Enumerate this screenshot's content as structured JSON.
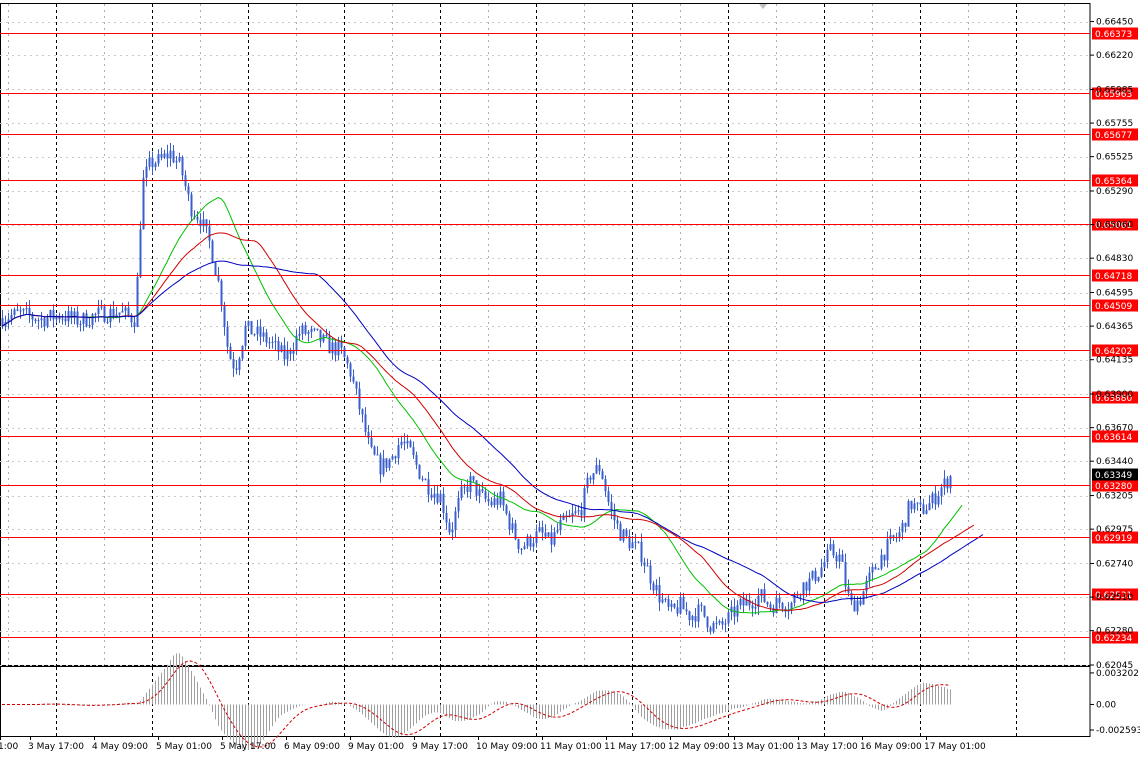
{
  "chart_data": {
    "type": "candlestick",
    "symbol_hint": "",
    "colors": {
      "background": "#ffffff",
      "grid": "#000000",
      "candles": "#3a5fcd",
      "level_lines": "#ff0000",
      "level_label_bg": "#ff0000",
      "ma_fast": "#00c000",
      "ma_mid": "#d00000",
      "ma_slow": "#0000c0",
      "osc_histogram": "#a0a0a0",
      "osc_signal": "#d00000",
      "last_price_bg": "#000000"
    },
    "price_axis": {
      "ticks": [
        "0.66450",
        "0.66220",
        "0.65985",
        "0.65755",
        "0.65525",
        "0.65290",
        "0.65060",
        "0.64830",
        "0.64595",
        "0.64365",
        "0.64135",
        "0.63900",
        "0.63670",
        "0.63440",
        "0.63205",
        "0.62975",
        "0.62740",
        "0.62510",
        "0.62280",
        "0.62045"
      ],
      "ylim": [
        0.62045,
        0.6657
      ]
    },
    "levels": [
      "0.66373",
      "0.65963",
      "0.65677",
      "0.65364",
      "0.65061",
      "0.64718",
      "0.64509",
      "0.64202",
      "0.63880",
      "0.63614",
      "0.63280",
      "0.62919",
      "0.62531",
      "0.62234"
    ],
    "last_price": "0.63349",
    "time_axis": {
      "labels": [
        "1:00",
        "3 May 17:00",
        "4 May 09:00",
        "5 May 01:00",
        "5 May 17:00",
        "6 May 09:00",
        "9 May 01:00",
        "9 May 17:00",
        "10 May 09:00",
        "11 May 01:00",
        "11 May 17:00",
        "12 May 09:00",
        "13 May 01:00",
        "13 May 17:00",
        "16 May 09:00",
        "17 May 01:00"
      ]
    },
    "price_path": [
      [
        0,
        0.6442
      ],
      [
        20,
        0.6445
      ],
      [
        40,
        0.6441
      ],
      [
        60,
        0.6444
      ],
      [
        80,
        0.644
      ],
      [
        100,
        0.6445
      ],
      [
        120,
        0.6446
      ],
      [
        135,
        0.6441
      ],
      [
        142,
        0.6534
      ],
      [
        150,
        0.6548
      ],
      [
        160,
        0.655
      ],
      [
        170,
        0.6555
      ],
      [
        180,
        0.6546
      ],
      [
        190,
        0.6518
      ],
      [
        200,
        0.651
      ],
      [
        210,
        0.6492
      ],
      [
        220,
        0.646
      ],
      [
        228,
        0.6418
      ],
      [
        235,
        0.6408
      ],
      [
        245,
        0.6435
      ],
      [
        260,
        0.643
      ],
      [
        270,
        0.6425
      ],
      [
        285,
        0.6415
      ],
      [
        300,
        0.6433
      ],
      [
        315,
        0.643
      ],
      [
        330,
        0.6422
      ],
      [
        340,
        0.642
      ],
      [
        350,
        0.6405
      ],
      [
        360,
        0.6378
      ],
      [
        370,
        0.635
      ],
      [
        380,
        0.634
      ],
      [
        390,
        0.6345
      ],
      [
        400,
        0.6358
      ],
      [
        410,
        0.635
      ],
      [
        420,
        0.6335
      ],
      [
        430,
        0.6325
      ],
      [
        440,
        0.632
      ],
      [
        450,
        0.6295
      ],
      [
        460,
        0.632
      ],
      [
        470,
        0.633
      ],
      [
        480,
        0.632
      ],
      [
        490,
        0.6315
      ],
      [
        500,
        0.6318
      ],
      [
        510,
        0.63
      ],
      [
        520,
        0.6285
      ],
      [
        530,
        0.629
      ],
      [
        540,
        0.6295
      ],
      [
        550,
        0.6288
      ],
      [
        560,
        0.63
      ],
      [
        570,
        0.6305
      ],
      [
        580,
        0.631
      ],
      [
        590,
        0.6335
      ],
      [
        600,
        0.634
      ],
      [
        605,
        0.6325
      ],
      [
        610,
        0.631
      ],
      [
        620,
        0.6295
      ],
      [
        630,
        0.6288
      ],
      [
        640,
        0.6282
      ],
      [
        650,
        0.6265
      ],
      [
        660,
        0.625
      ],
      [
        670,
        0.624
      ],
      [
        680,
        0.6245
      ],
      [
        690,
        0.6238
      ],
      [
        700,
        0.6242
      ],
      [
        710,
        0.6232
      ],
      [
        720,
        0.623
      ],
      [
        730,
        0.6238
      ],
      [
        740,
        0.6245
      ],
      [
        750,
        0.6248
      ],
      [
        760,
        0.6252
      ],
      [
        770,
        0.6245
      ],
      [
        780,
        0.6248
      ],
      [
        790,
        0.6245
      ],
      [
        800,
        0.6258
      ],
      [
        810,
        0.6262
      ],
      [
        820,
        0.627
      ],
      [
        830,
        0.6282
      ],
      [
        840,
        0.6278
      ],
      [
        845,
        0.626
      ],
      [
        850,
        0.6245
      ],
      [
        860,
        0.625
      ],
      [
        870,
        0.6265
      ],
      [
        880,
        0.6278
      ],
      [
        890,
        0.6288
      ],
      [
        900,
        0.6295
      ],
      [
        910,
        0.6315
      ],
      [
        920,
        0.631
      ],
      [
        930,
        0.6315
      ],
      [
        940,
        0.6325
      ],
      [
        952,
        0.6335
      ]
    ],
    "oscillator": {
      "ticks": [
        "0.003202",
        "0.00",
        "-0.002593"
      ],
      "ylim": [
        -0.0032,
        0.0038
      ]
    }
  }
}
